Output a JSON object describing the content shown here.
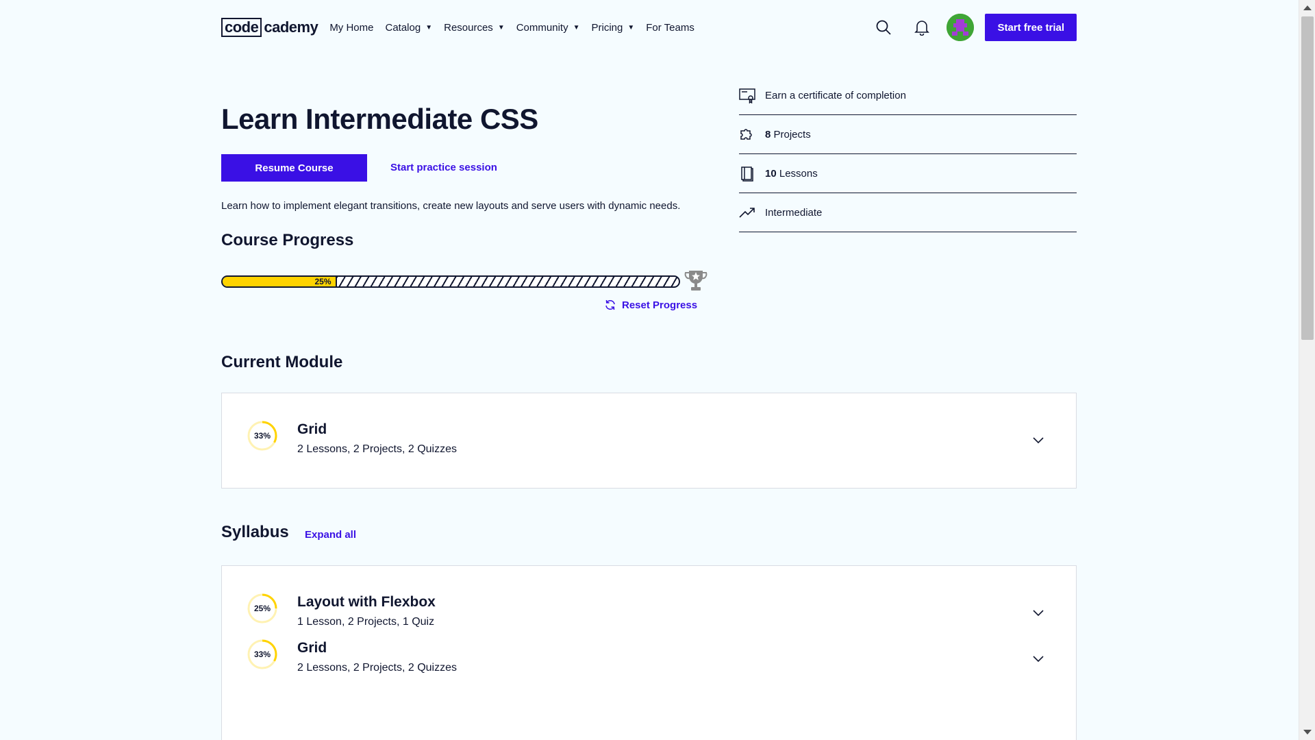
{
  "header": {
    "logo": {
      "code": "code",
      "cademy": "cademy"
    },
    "nav": [
      {
        "label": "My Home",
        "dropdown": false
      },
      {
        "label": "Catalog",
        "dropdown": true
      },
      {
        "label": "Resources",
        "dropdown": true
      },
      {
        "label": "Community",
        "dropdown": true
      },
      {
        "label": "Pricing",
        "dropdown": true
      },
      {
        "label": "For Teams",
        "dropdown": false
      }
    ],
    "cta_label": "Start free trial"
  },
  "course": {
    "title": "Learn Intermediate CSS",
    "resume_label": "Resume Course",
    "practice_label": "Start practice session",
    "description": "Learn how to implement elegant transitions, create new layouts and serve users with dynamic needs."
  },
  "progress": {
    "heading": "Course Progress",
    "percent": 25,
    "percent_label": "25%",
    "reset_label": "Reset Progress"
  },
  "info": [
    {
      "icon": "certificate-icon",
      "bold": "",
      "text": "Earn a certificate of completion"
    },
    {
      "icon": "puzzle-icon",
      "bold": "8",
      "text": " Projects"
    },
    {
      "icon": "book-icon",
      "bold": "10",
      "text": " Lessons"
    },
    {
      "icon": "trend-up-icon",
      "bold": "",
      "text": "Intermediate"
    }
  ],
  "current_module": {
    "heading": "Current Module",
    "module": {
      "title": "Grid",
      "subtitle": "2 Lessons, 2 Projects, 2 Quizzes",
      "percent": 33,
      "percent_label": "33%"
    }
  },
  "syllabus": {
    "heading": "Syllabus",
    "expand_label": "Expand all",
    "modules": [
      {
        "title": "Layout with Flexbox",
        "subtitle": "1 Lesson, 2 Projects, 1 Quiz",
        "percent": 25,
        "percent_label": "25%"
      },
      {
        "title": "Grid",
        "subtitle": "2 Lessons, 2 Projects, 2 Quizzes",
        "percent": 33,
        "percent_label": "33%"
      }
    ]
  },
  "colors": {
    "accent": "#3a10e5",
    "progress": "#ffd300",
    "text": "#10162f",
    "background": "#f5fcff"
  }
}
